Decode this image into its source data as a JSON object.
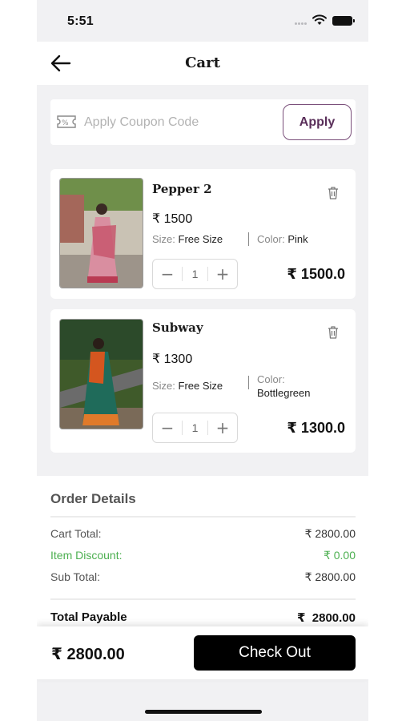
{
  "status_bar": {
    "time": "5:51"
  },
  "header": {
    "title": "Cart",
    "back_icon": "arrow-left-icon"
  },
  "coupon": {
    "placeholder": "Apply Coupon Code",
    "value": "",
    "apply_label": "Apply",
    "icon": "coupon-ticket-icon"
  },
  "cart_items": [
    {
      "name": "Pepper 2",
      "price": "₹ 1500",
      "size_label": "Size:",
      "size_value": "Free Size",
      "color_label": "Color:",
      "color_value": "Pink",
      "quantity": "1",
      "line_total": "₹ 1500.0",
      "image_colors": [
        "#c98a95",
        "#5a7a3a",
        "#e8c7b8"
      ]
    },
    {
      "name": "Subway",
      "price": "₹ 1300",
      "size_label": "Size:",
      "size_value": "Free Size",
      "color_label": "Color:",
      "color_value": "Bottlegreen",
      "quantity": "1",
      "line_total": "₹ 1300.0",
      "image_colors": [
        "#1f6b5a",
        "#d4561f",
        "#3f5a2a"
      ]
    }
  ],
  "order_details": {
    "heading": "Order Details",
    "cart_total_label": "Cart Total:",
    "cart_total_value": "₹ 2800.00",
    "discount_label": "Item Discount:",
    "discount_value": "₹ 0.00",
    "sub_total_label": "Sub Total:",
    "sub_total_value": "₹ 2800.00",
    "payable_label": "Total Payable",
    "payable_value": "₹  2800.00"
  },
  "bottom_bar": {
    "amount": "₹ 2800.00",
    "checkout_label": "Check Out"
  },
  "colors": {
    "accent_purple": "#7a4f7a",
    "discount_green": "#4caf50",
    "checkout_bg": "#000000",
    "page_bg": "#f1f1f3"
  }
}
